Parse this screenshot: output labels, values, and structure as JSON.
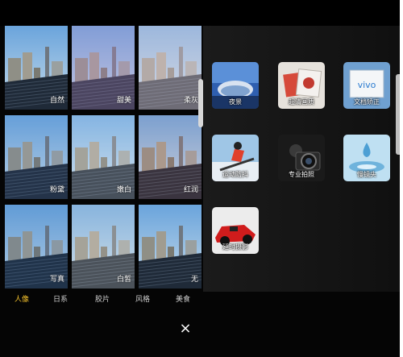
{
  "filters": [
    {
      "label": "自然",
      "tint": "#000000",
      "tint_opacity": 0.0
    },
    {
      "label": "甜美",
      "tint": "#c08cc8",
      "tint_opacity": 0.28
    },
    {
      "label": "柔灰",
      "tint": "#f0d8dc",
      "tint_opacity": 0.38
    },
    {
      "label": "粉黛",
      "tint": "#4a78c8",
      "tint_opacity": 0.12
    },
    {
      "label": "嫩白",
      "tint": "#ffffff",
      "tint_opacity": 0.18
    },
    {
      "label": "红润",
      "tint": "#ff8070",
      "tint_opacity": 0.12
    },
    {
      "label": "写真",
      "tint": "#2a6ab8",
      "tint_opacity": 0.14
    },
    {
      "label": "白皙",
      "tint": "#fff6e8",
      "tint_opacity": 0.2
    },
    {
      "label": "无",
      "tint": "#000000",
      "tint_opacity": 0.0
    }
  ],
  "tabs": [
    {
      "label": "人像",
      "active": true
    },
    {
      "label": "日系",
      "active": false
    },
    {
      "label": "胶片",
      "active": false
    },
    {
      "label": "风格",
      "active": false
    },
    {
      "label": "美食",
      "active": false
    }
  ],
  "modes": [
    {
      "label": "夜景",
      "icon": "night-scene-icon"
    },
    {
      "label": "超清画质",
      "icon": "hd-quality-icon"
    },
    {
      "label": "文档矫正",
      "icon": "document-correction-icon",
      "logo_text": "vivo"
    },
    {
      "label": "运动防抖",
      "icon": "sports-stabilization-icon"
    },
    {
      "label": "专业拍照",
      "icon": "professional-camera-icon"
    },
    {
      "label": "慢镜头",
      "icon": "slow-motion-icon"
    },
    {
      "label": "延时摄影",
      "icon": "time-lapse-icon"
    }
  ],
  "close_glyph": "×",
  "colors": {
    "accent": "#f2c02c",
    "tab_text": "#cfcfcf",
    "background": "#050505"
  }
}
